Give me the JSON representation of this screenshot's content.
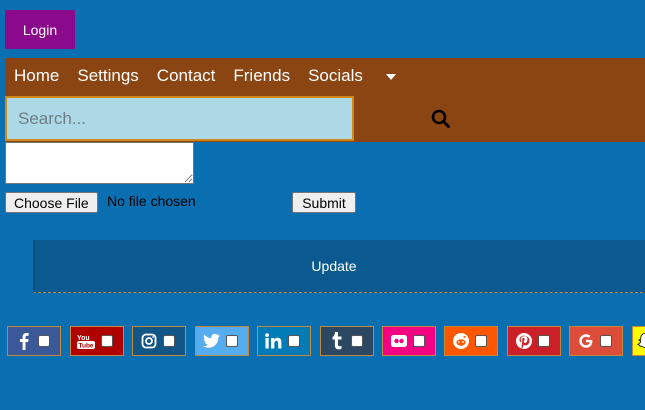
{
  "login": {
    "label": "Login"
  },
  "nav": {
    "links": [
      "Home",
      "Settings",
      "Contact",
      "Friends",
      "Socials"
    ]
  },
  "search": {
    "placeholder": "Search..."
  },
  "file": {
    "button_label": "Choose File",
    "status": "No file chosen"
  },
  "submit": {
    "label": "Submit"
  },
  "update": {
    "label": "Update"
  },
  "social": [
    {
      "name": "facebook",
      "icon": "facebook-icon",
      "color": "#3b5998"
    },
    {
      "name": "youtube",
      "icon": "youtube-icon",
      "color": "#b00000"
    },
    {
      "name": "instagram",
      "icon": "instagram-icon",
      "color": "#125688"
    },
    {
      "name": "twitter",
      "icon": "twitter-icon",
      "color": "#55acee"
    },
    {
      "name": "linkedin",
      "icon": "linkedin-icon",
      "color": "#007bb5"
    },
    {
      "name": "tumblr",
      "icon": "tumblr-icon",
      "color": "#2c4762"
    },
    {
      "name": "flickr",
      "icon": "flickr-icon",
      "color": "#f40083"
    },
    {
      "name": "reddit",
      "icon": "reddit-icon",
      "color": "#ff5700"
    },
    {
      "name": "pinterest",
      "icon": "pinterest-icon",
      "color": "#cb2027"
    },
    {
      "name": "google",
      "icon": "google-icon",
      "color": "#dd4b39"
    },
    {
      "name": "snapchat",
      "icon": "snapchat-icon",
      "color": "#fffc00"
    }
  ]
}
